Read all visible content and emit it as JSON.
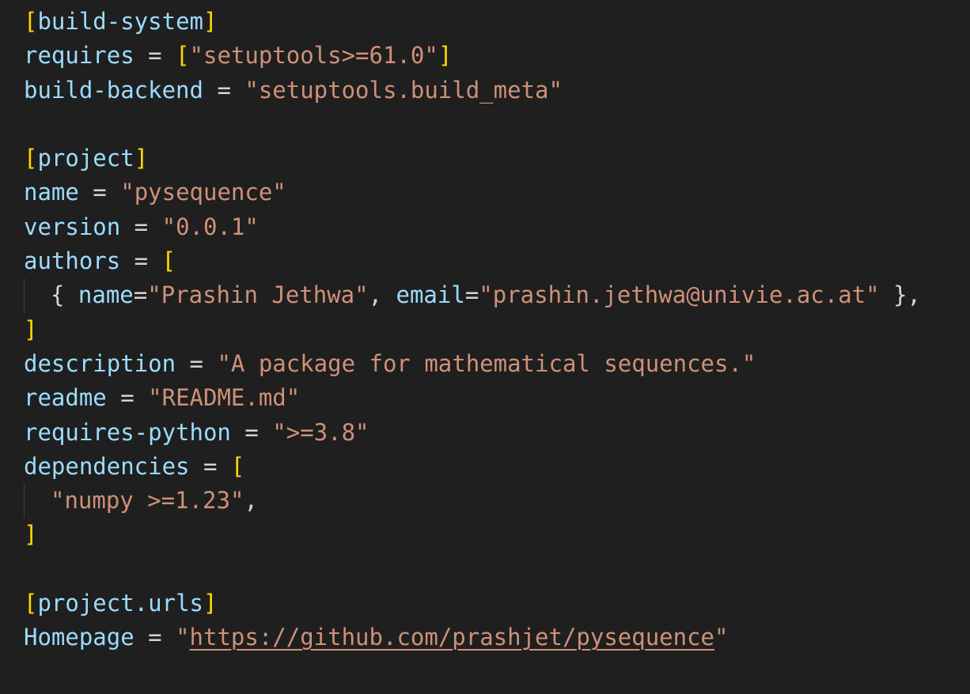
{
  "editor": {
    "language": "toml",
    "theme_colors": {
      "background": "#1f1f1f",
      "key": "#9cdcfe",
      "string": "#ce9178",
      "bracket": "#ffd700",
      "default": "#d4d4d4",
      "indent_guide": "#404040"
    },
    "lines": [
      {
        "tokens": [
          {
            "t": "br",
            "v": "["
          },
          {
            "t": "tbl",
            "v": "build-system"
          },
          {
            "t": "br",
            "v": "]"
          }
        ]
      },
      {
        "tokens": [
          {
            "t": "key",
            "v": "requires"
          },
          {
            "t": "op",
            "v": " = "
          },
          {
            "t": "br",
            "v": "["
          },
          {
            "t": "str",
            "v": "\"setuptools>=61.0\""
          },
          {
            "t": "br",
            "v": "]"
          }
        ]
      },
      {
        "tokens": [
          {
            "t": "key",
            "v": "build-backend"
          },
          {
            "t": "op",
            "v": " = "
          },
          {
            "t": "str",
            "v": "\"setuptools.build_meta\""
          }
        ]
      },
      {
        "tokens": []
      },
      {
        "tokens": [
          {
            "t": "br",
            "v": "["
          },
          {
            "t": "tbl",
            "v": "project"
          },
          {
            "t": "br",
            "v": "]"
          }
        ]
      },
      {
        "tokens": [
          {
            "t": "key",
            "v": "name"
          },
          {
            "t": "op",
            "v": " = "
          },
          {
            "t": "str",
            "v": "\"pysequence\""
          }
        ]
      },
      {
        "tokens": [
          {
            "t": "key",
            "v": "version"
          },
          {
            "t": "op",
            "v": " = "
          },
          {
            "t": "str",
            "v": "\"0.0.1\""
          }
        ]
      },
      {
        "tokens": [
          {
            "t": "key",
            "v": "authors"
          },
          {
            "t": "op",
            "v": " = "
          },
          {
            "t": "br",
            "v": "["
          }
        ]
      },
      {
        "indent": true,
        "tokens": [
          {
            "t": "punc",
            "v": "{ "
          },
          {
            "t": "key",
            "v": "name"
          },
          {
            "t": "op",
            "v": "="
          },
          {
            "t": "str",
            "v": "\"Prashin Jethwa\""
          },
          {
            "t": "punc",
            "v": ", "
          },
          {
            "t": "key",
            "v": "email"
          },
          {
            "t": "op",
            "v": "="
          },
          {
            "t": "str",
            "v": "\"prashin.jethwa@univie.ac.at\""
          },
          {
            "t": "punc",
            "v": " },"
          }
        ]
      },
      {
        "tokens": [
          {
            "t": "br",
            "v": "]"
          }
        ]
      },
      {
        "tokens": [
          {
            "t": "key",
            "v": "description"
          },
          {
            "t": "op",
            "v": " = "
          },
          {
            "t": "str",
            "v": "\"A package for mathematical sequences.\""
          }
        ]
      },
      {
        "tokens": [
          {
            "t": "key",
            "v": "readme"
          },
          {
            "t": "op",
            "v": " = "
          },
          {
            "t": "str",
            "v": "\"README.md\""
          }
        ]
      },
      {
        "tokens": [
          {
            "t": "key",
            "v": "requires-python"
          },
          {
            "t": "op",
            "v": " = "
          },
          {
            "t": "str",
            "v": "\">=3.8\""
          }
        ]
      },
      {
        "tokens": [
          {
            "t": "key",
            "v": "dependencies"
          },
          {
            "t": "op",
            "v": " = "
          },
          {
            "t": "br",
            "v": "["
          }
        ]
      },
      {
        "indent": true,
        "tokens": [
          {
            "t": "str",
            "v": "\"numpy >=1.23\""
          },
          {
            "t": "punc",
            "v": ","
          }
        ]
      },
      {
        "tokens": [
          {
            "t": "br",
            "v": "]"
          }
        ]
      },
      {
        "tokens": []
      },
      {
        "tokens": [
          {
            "t": "br",
            "v": "["
          },
          {
            "t": "tbl",
            "v": "project.urls"
          },
          {
            "t": "br",
            "v": "]"
          }
        ]
      },
      {
        "tokens": [
          {
            "t": "key",
            "v": "Homepage"
          },
          {
            "t": "op",
            "v": " = "
          },
          {
            "t": "str",
            "v": "\""
          },
          {
            "t": "url",
            "v": "https://github.com/prashjet/pysequence"
          },
          {
            "t": "str",
            "v": "\""
          }
        ]
      }
    ]
  }
}
